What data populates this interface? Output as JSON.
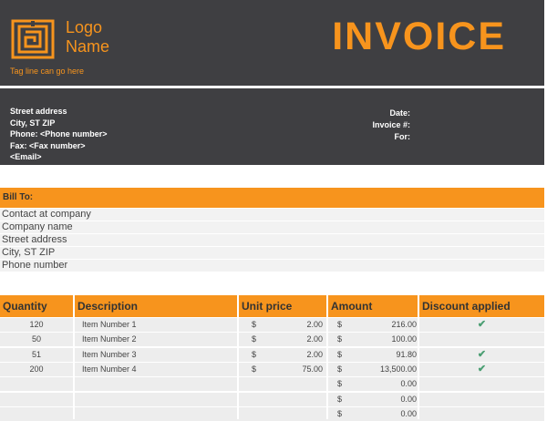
{
  "header": {
    "logo_line1": "Logo",
    "logo_line2": "Name",
    "tagline": "Tag line can go here",
    "title": "INVOICE",
    "address_lines": [
      "Street address",
      "City, ST  ZIP",
      "Phone: <Phone number>",
      "Fax: <Fax number>",
      "<Email>"
    ],
    "meta_labels": [
      "Date:",
      "Invoice #:",
      "For:"
    ]
  },
  "bill_to": {
    "heading": "Bill To:",
    "lines": [
      "Contact at company",
      "Company name",
      "Street address",
      "City, ST  ZIP",
      "Phone number"
    ]
  },
  "table": {
    "columns": [
      "Quantity",
      "Description",
      "Unit price",
      "Amount",
      "Discount applied"
    ],
    "rows": [
      {
        "qty": "120",
        "desc": "Item Number 1",
        "cur1": "$",
        "unit": "2.00",
        "cur2": "$",
        "amount": "216.00",
        "discount": true
      },
      {
        "qty": "50",
        "desc": "Item Number 2",
        "cur1": "$",
        "unit": "2.00",
        "cur2": "$",
        "amount": "100.00",
        "discount": false
      },
      {
        "qty": "51",
        "desc": "Item Number 3",
        "cur1": "$",
        "unit": "2.00",
        "cur2": "$",
        "amount": "91.80",
        "discount": true
      },
      {
        "qty": "200",
        "desc": "Item Number 4",
        "cur1": "$",
        "unit": "75.00",
        "cur2": "$",
        "amount": "13,500.00",
        "discount": true
      },
      {
        "qty": "",
        "desc": "",
        "cur1": "",
        "unit": "",
        "cur2": "$",
        "amount": "0.00",
        "discount": false
      },
      {
        "qty": "",
        "desc": "",
        "cur1": "",
        "unit": "",
        "cur2": "$",
        "amount": "0.00",
        "discount": false
      },
      {
        "qty": "",
        "desc": "",
        "cur1": "",
        "unit": "",
        "cur2": "$",
        "amount": "0.00",
        "discount": false
      }
    ],
    "check_glyph": "✔"
  },
  "colors": {
    "accent": "#f7941d",
    "header_bg": "#3f3f42",
    "row_bg": "#ededed",
    "check": "#4a9e72"
  },
  "icons": {
    "logo": "maze-square-logo",
    "discount": "check-mark-icon"
  }
}
